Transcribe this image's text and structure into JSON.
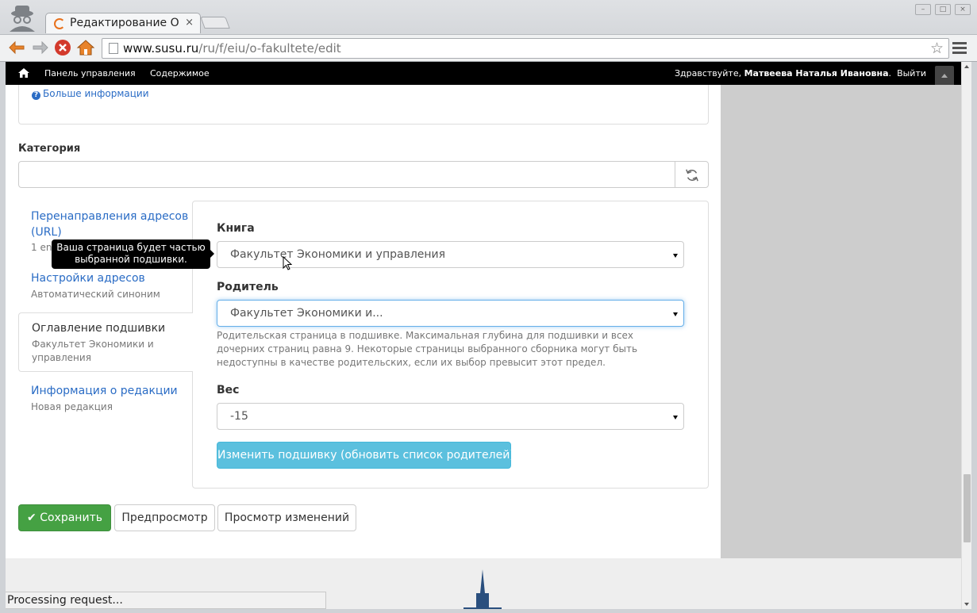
{
  "browser": {
    "tab_title": "Редактирование О",
    "tab_close": "×",
    "url_host": "www.susu.ru",
    "url_path": "/ru/f/eiu/o-fakultete/edit",
    "window_buttons": [
      "–",
      "□",
      "×"
    ]
  },
  "admin_bar": {
    "home_icon": "home-icon",
    "links": [
      "Панель управления",
      "Содержимое"
    ],
    "greeting": "Здравствуйте,",
    "user_name": "Матвеева Наталья Ивановна",
    "greeting_end": ".",
    "logout": "Выйти"
  },
  "top_panel": {
    "more_info": "Больше информации",
    "info_icon": "question-circle-icon"
  },
  "category": {
    "label": "Категория",
    "value": "",
    "refresh_icon": "refresh-icon"
  },
  "vertical_tabs": [
    {
      "title": "Перенаправления адресов (URL)",
      "subtitle": "1 en"
    },
    {
      "title": "Настройки адресов",
      "subtitle": "Автоматический синоним"
    },
    {
      "title": "Оглавление подшивки",
      "subtitle": "Факультет Экономики и управления",
      "active": true
    },
    {
      "title": "Информация о редакции",
      "subtitle": "Новая редакция"
    }
  ],
  "tooltip": "Ваша страница будет частью выбранной подшивки.",
  "book_form": {
    "book_label": "Книга",
    "book_value": "Факультет Экономики и управления",
    "parent_label": "Родитель",
    "parent_value": "Факультет Экономики и...",
    "parent_help": "Родительская страница в подшивке. Максимальная глубина для подшивки и всех дочерних страниц равна 9. Некоторые страницы выбранного сборника могут быть недоступны в качестве родительских, если их выбор превысит этот предел.",
    "weight_label": "Вес",
    "weight_value": "-15",
    "change_button": "Изменить подшивку (обновить список родителей)"
  },
  "actions": {
    "save": "Сохранить",
    "preview": "Предпросмотр",
    "view_changes": "Просмотр изменений"
  },
  "status": "Processing request...",
  "colors": {
    "link": "#2a6cc5",
    "success": "#45a143",
    "info": "#5bc0de",
    "admin_bar": "#000000"
  }
}
